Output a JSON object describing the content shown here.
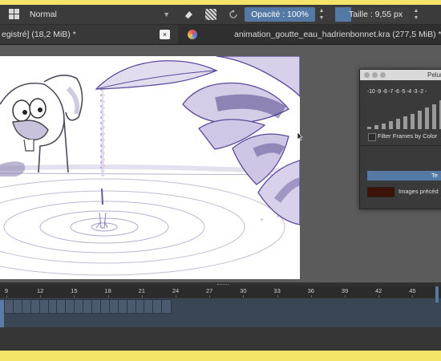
{
  "toolbar": {
    "blend_mode": "Normal",
    "opacity_label": "Opacité : 100%",
    "size_label": "Taille :  9,55 px"
  },
  "tabs": [
    {
      "title": "egistré]  (18,2 MiB) *",
      "close": "×"
    },
    {
      "title": "animation_goutte_eau_hadrienbonnet.kra  (277,5 MiB) *"
    }
  ],
  "onion_docker": {
    "title": "Pelur",
    "frame_numbers": "-10 -9 -8 -7 -6 -5 -4 -3 -2 -",
    "filter_label": "Filter Frames by Color",
    "blue_strip_label": "Te",
    "previous_label": "Images précéd",
    "previous_color": "#3e1206",
    "bar_levels": [
      0.08,
      0.14,
      0.2,
      0.28,
      0.36,
      0.45,
      0.54,
      0.64,
      0.75,
      0.87,
      1.0
    ]
  },
  "timeline": {
    "ruler_labels": [
      "9",
      "12",
      "15",
      "18",
      "21",
      "24",
      "27",
      "30",
      "33",
      "36",
      "39",
      "42",
      "45",
      "4"
    ],
    "accent": "#5479a4",
    "cell_count": 19
  },
  "colors": {
    "accent": "#5479a4",
    "highlight_frame": "#f4e46a",
    "sketch": "#5a4a9a"
  }
}
